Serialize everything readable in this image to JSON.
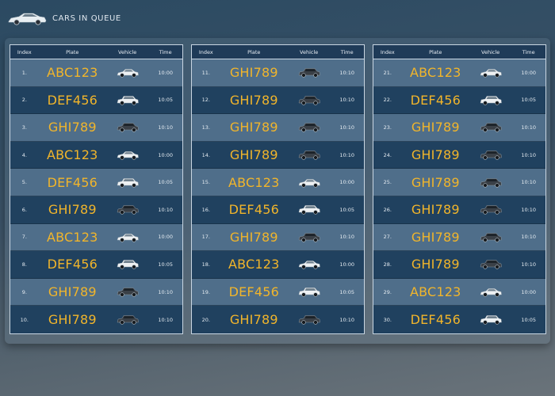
{
  "header": {
    "title": "CARS IN QUEUE",
    "logo_icon": "sports-car-icon"
  },
  "columns": {
    "index": "Index",
    "plate": "Plate",
    "vehicle": "Vehicle",
    "time": "Time"
  },
  "colors": {
    "plate_text": "#f1b52b",
    "row_light": "#4f6e8a",
    "row_dark": "#20415f",
    "header_bg": "#1f3b58"
  },
  "tables": [
    {
      "rows": [
        {
          "index": "1.",
          "plate": "ABC123",
          "vehicle": "white-sedan-icon",
          "time": "10:00"
        },
        {
          "index": "2.",
          "plate": "DEF456",
          "vehicle": "white-suv-icon",
          "time": "10:05"
        },
        {
          "index": "3.",
          "plate": "GHI789",
          "vehicle": "dark-suv-icon",
          "time": "10:10"
        },
        {
          "index": "4.",
          "plate": "ABC123",
          "vehicle": "white-sedan-icon",
          "time": "10:00"
        },
        {
          "index": "5.",
          "plate": "DEF456",
          "vehicle": "white-suv-icon",
          "time": "10:05"
        },
        {
          "index": "6.",
          "plate": "GHI789",
          "vehicle": "dark-suv-icon",
          "time": "10:10"
        },
        {
          "index": "7.",
          "plate": "ABC123",
          "vehicle": "white-sedan-icon",
          "time": "10:00"
        },
        {
          "index": "8.",
          "plate": "DEF456",
          "vehicle": "white-suv-icon",
          "time": "10:05"
        },
        {
          "index": "9.",
          "plate": "GHI789",
          "vehicle": "dark-suv-icon",
          "time": "10:10"
        },
        {
          "index": "10.",
          "plate": "GHI789",
          "vehicle": "dark-suv-icon",
          "time": "10:10"
        }
      ]
    },
    {
      "rows": [
        {
          "index": "11.",
          "plate": "GHI789",
          "vehicle": "dark-suv-icon",
          "time": "10:10"
        },
        {
          "index": "12.",
          "plate": "GHI789",
          "vehicle": "dark-suv-icon",
          "time": "10:10"
        },
        {
          "index": "13.",
          "plate": "GHI789",
          "vehicle": "dark-suv-icon",
          "time": "10:10"
        },
        {
          "index": "14.",
          "plate": "GHI789",
          "vehicle": "dark-suv-icon",
          "time": "10:10"
        },
        {
          "index": "15.",
          "plate": "ABC123",
          "vehicle": "white-sedan-icon",
          "time": "10:00"
        },
        {
          "index": "16.",
          "plate": "DEF456",
          "vehicle": "white-suv-icon",
          "time": "10:05"
        },
        {
          "index": "17.",
          "plate": "GHI789",
          "vehicle": "dark-suv-icon",
          "time": "10:10"
        },
        {
          "index": "18.",
          "plate": "ABC123",
          "vehicle": "white-sedan-icon",
          "time": "10:00"
        },
        {
          "index": "19.",
          "plate": "DEF456",
          "vehicle": "white-suv-icon",
          "time": "10:05"
        },
        {
          "index": "20.",
          "plate": "GHI789",
          "vehicle": "dark-suv-icon",
          "time": "10:10"
        }
      ]
    },
    {
      "rows": [
        {
          "index": "21.",
          "plate": "ABC123",
          "vehicle": "white-sedan-icon",
          "time": "10:00"
        },
        {
          "index": "22.",
          "plate": "DEF456",
          "vehicle": "white-suv-icon",
          "time": "10:05"
        },
        {
          "index": "23.",
          "plate": "GHI789",
          "vehicle": "dark-suv-icon",
          "time": "10:10"
        },
        {
          "index": "24.",
          "plate": "GHI789",
          "vehicle": "dark-suv-icon",
          "time": "10:10"
        },
        {
          "index": "25.",
          "plate": "GHI789",
          "vehicle": "dark-suv-icon",
          "time": "10:10"
        },
        {
          "index": "26.",
          "plate": "GHI789",
          "vehicle": "dark-suv-icon",
          "time": "10:10"
        },
        {
          "index": "27.",
          "plate": "GHI789",
          "vehicle": "dark-suv-icon",
          "time": "10:10"
        },
        {
          "index": "28.",
          "plate": "GHI789",
          "vehicle": "dark-suv-icon",
          "time": "10:10"
        },
        {
          "index": "29.",
          "plate": "ABC123",
          "vehicle": "white-sedan-icon",
          "time": "10:00"
        },
        {
          "index": "30.",
          "plate": "DEF456",
          "vehicle": "white-suv-icon",
          "time": "10:05"
        }
      ]
    }
  ]
}
